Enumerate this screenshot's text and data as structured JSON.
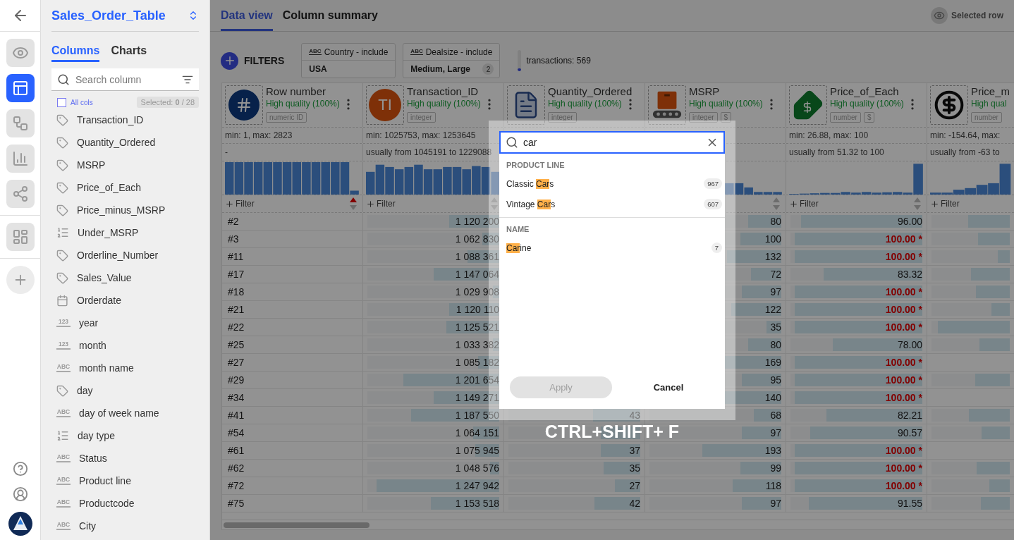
{
  "rail": {
    "items": [
      {
        "kind": "preview",
        "selected": false
      },
      {
        "kind": "table",
        "selected": true
      },
      {
        "kind": "flow",
        "selected": false
      },
      {
        "kind": "chart",
        "selected": false
      },
      {
        "kind": "network",
        "selected": false
      },
      {
        "kind": "dashboard",
        "selected": false
      }
    ]
  },
  "sidebar": {
    "title": "Sales_Order_Table",
    "tabs": [
      {
        "label": "Columns",
        "selected": true
      },
      {
        "label": "Charts",
        "selected": false
      }
    ],
    "search": {
      "placeholder": "Search column"
    },
    "all_cols": {
      "label": "All cols",
      "checked": false
    },
    "selected_count": "Selected: **0** / 28",
    "columns": [
      {
        "name": "Transaction_ID",
        "kind": "measure"
      },
      {
        "name": "Quantity_Ordered",
        "kind": "measure"
      },
      {
        "name": "MSRP",
        "kind": "measure"
      },
      {
        "name": "Price_of_Each",
        "kind": "measure"
      },
      {
        "name": "Price_minus_MSRP",
        "kind": "measure"
      },
      {
        "name": "Under_MSRP",
        "kind": "binary"
      },
      {
        "name": "Orderline_Number",
        "kind": "measure"
      },
      {
        "name": "Sales_Value",
        "kind": "measure"
      },
      {
        "name": "Orderdate",
        "kind": "date"
      },
      {
        "name": "year",
        "kind": "label",
        "type_label": "123"
      },
      {
        "name": "month",
        "kind": "label",
        "type_label": "123"
      },
      {
        "name": "month name",
        "kind": "label",
        "type_label": "ABC"
      },
      {
        "name": "day",
        "kind": "measure"
      },
      {
        "name": "day of week name",
        "kind": "label",
        "type_label": "ABC"
      },
      {
        "name": "day type",
        "kind": "binary"
      },
      {
        "name": "Status",
        "kind": "label",
        "type_label": "ABC"
      },
      {
        "name": "Product line",
        "kind": "label",
        "type_label": "ABC"
      },
      {
        "name": "Productcode",
        "kind": "label",
        "type_label": "ABC"
      },
      {
        "name": "City",
        "kind": "label",
        "type_label": "ABC"
      }
    ]
  },
  "tabs": [
    {
      "label": "Data view",
      "selected": true
    },
    {
      "label": "Column summary",
      "selected": false
    }
  ],
  "selected_row": {
    "label": "Selected row"
  },
  "filters": {
    "label": "FILTERS",
    "chips": [
      {
        "type_label": "ABC",
        "title": "Country - include",
        "value": "USA"
      },
      {
        "type_label": "ABC",
        "title": "Dealsize - include",
        "value": "Medium, Large",
        "count": "2"
      }
    ],
    "transactions": {
      "label": "transactions: 569",
      "level": 0.15
    }
  },
  "table": {
    "columns": [
      {
        "title": "Row number",
        "kind": "hash",
        "quality": "High quality (100%)",
        "tags": [
          "numeric ID"
        ],
        "min_max": "min: 1, max: 2823",
        "usually": "-",
        "filter": "Filter",
        "sort_asc": true,
        "cut": false
      },
      {
        "title": "Transaction_ID",
        "kind": "avatar",
        "avatar_text": "TI",
        "quality": "High quality (100%)",
        "tags": [
          "integer"
        ],
        "min_max": "min: 1025753, max: 1253645",
        "usually": "usually from 1045191 to 1229088",
        "filter": "Filter",
        "sort_asc": false,
        "cut": false
      },
      {
        "title": "Quantity_Ordered",
        "kind": "document",
        "quality": "High quality (100%)",
        "tags": [
          "integer"
        ],
        "cut": false
      },
      {
        "title": "MSRP",
        "kind": "conveyor",
        "quality": "High quality (100%)",
        "tags": [
          "integer",
          "$"
        ],
        "sort_asc": false,
        "cut": false
      },
      {
        "title": "Price_of_Each",
        "kind": "price-tag",
        "quality": "High quality (100%)",
        "tags": [
          "number",
          "$"
        ],
        "min_max": "min: 26.88, max: 100",
        "usually": "usually from 51.32 to 100",
        "filter": "Filter",
        "sort_asc": false,
        "cut": false
      },
      {
        "title": "Price_m",
        "kind": "dollar-cycle",
        "quality": "High qual",
        "tags": [
          "number"
        ],
        "min_max": "min: -154.64, max:",
        "usually": "usually from -63 to",
        "filter": "Filter",
        "cut": true
      }
    ],
    "rows": [
      {
        "cells": [
          {
            "value": "#2"
          },
          {
            "value": "1 120 200",
            "level": 0.38
          },
          null,
          {
            "value": "80",
            "level": 0.25
          },
          {
            "value": "96.00",
            "level": 0.92,
            "flagged": false
          },
          {
            "level": 0.53
          }
        ]
      },
      {
        "cells": [
          {
            "value": "#3"
          },
          {
            "value": "1 062 830",
            "level": 0.13
          },
          null,
          {
            "value": "100",
            "level": 0.31
          },
          {
            "value": "100.00 *",
            "level": 0.97,
            "flagged": true
          },
          {
            "level": 0.41
          }
        ]
      },
      {
        "cells": [
          {
            "value": "#11"
          },
          {
            "value": "1 088 361",
            "level": 0.24
          },
          null,
          {
            "value": "132",
            "level": 0.41
          },
          {
            "value": "100.00 *",
            "level": 0.97,
            "flagged": true
          },
          {
            "level": 0.15
          }
        ]
      },
      {
        "cells": [
          {
            "value": "#17"
          },
          {
            "value": "1 147 064",
            "level": 0.5
          },
          null,
          {
            "value": "72",
            "level": 0.23
          },
          {
            "value": "83.32",
            "level": 0.75,
            "flagged": false
          },
          {
            "level": 0.5
          }
        ]
      },
      {
        "cells": [
          {
            "value": "#18"
          },
          {
            "value": "1 029 908",
            "level": 0.05
          },
          null,
          {
            "value": "97",
            "level": 0.3
          },
          {
            "value": "100.00 *",
            "level": 0.97,
            "flagged": true
          },
          {
            "level": 0.43
          }
        ]
      },
      {
        "cells": [
          {
            "value": "#21"
          },
          {
            "value": "1 120 110",
            "level": 0.38
          },
          null,
          {
            "value": "122",
            "level": 0.38
          },
          {
            "value": "100.00 *",
            "level": 0.97,
            "flagged": true
          },
          {
            "level": 0.23
          }
        ]
      },
      {
        "cells": [
          {
            "value": "#22"
          },
          {
            "value": "1 125 521",
            "level": 0.4
          },
          null,
          {
            "value": "35",
            "level": 0.11
          },
          {
            "value": "100.00 *",
            "level": 0.97,
            "flagged": true
          },
          {
            "level": 0.92
          }
        ]
      },
      {
        "cells": [
          {
            "value": "#25"
          },
          {
            "value": "1 033 382",
            "level": 0.05
          },
          null,
          {
            "value": "80",
            "level": 0.25
          },
          {
            "value": "78.00",
            "level": 0.68,
            "flagged": false
          },
          {
            "level": 0.39
          }
        ]
      },
      {
        "cells": [
          {
            "value": "#27"
          },
          {
            "value": "1 085 182",
            "level": 0.16
          },
          null,
          {
            "value": "169",
            "level": 0.53
          },
          {
            "value": "100.00 *",
            "level": 0.97,
            "flagged": true
          },
          null
        ]
      },
      {
        "cells": [
          {
            "value": "#29"
          },
          {
            "value": "1 201 654",
            "level": 0.73
          },
          null,
          {
            "value": "95",
            "level": 0.3
          },
          {
            "value": "100.00 *",
            "level": 0.97,
            "flagged": true
          },
          {
            "level": 0.44
          }
        ]
      },
      {
        "cells": [
          {
            "value": "#34"
          },
          {
            "value": "1 149 271",
            "level": 0.5
          },
          null,
          {
            "value": "140",
            "level": 0.44
          },
          {
            "value": "100.00 *",
            "level": 0.97,
            "flagged": true
          },
          null
        ]
      },
      {
        "cells": [
          {
            "value": "#41"
          },
          {
            "value": "1 187 550",
            "level": 0.67
          },
          {
            "value": "43",
            "level": 0.36
          },
          {
            "value": "68",
            "level": 0.21
          },
          {
            "value": "82.21",
            "level": 0.73,
            "flagged": false
          },
          {
            "level": 0.52
          }
        ]
      },
      {
        "cells": [
          {
            "value": "#54"
          },
          {
            "value": "1 064 151",
            "level": 0.2
          },
          {
            "level": 0.3
          },
          {
            "value": "97",
            "level": 0.3
          },
          {
            "value": "90.57",
            "level": 0.85,
            "flagged": false
          },
          {
            "level": 0.36
          }
        ]
      },
      {
        "cells": [
          {
            "value": "#61"
          },
          {
            "value": "1 075 945",
            "level": 0.18
          },
          {
            "value": "37",
            "level": 0.3
          },
          {
            "value": "193",
            "level": 0.6
          },
          {
            "value": "100.00 *",
            "level": 0.97,
            "flagged": true
          },
          null
        ]
      },
      {
        "cells": [
          {
            "value": "#62"
          },
          {
            "value": "1 048 576",
            "level": 0.07
          },
          {
            "value": "35",
            "level": 0.28
          },
          {
            "value": "99",
            "level": 0.31
          },
          {
            "value": "100.00 *",
            "level": 0.97,
            "flagged": true
          },
          {
            "level": 0.42
          }
        ]
      },
      {
        "cells": [
          {
            "value": "#72"
          },
          {
            "value": "1 247 942",
            "level": 0.93
          },
          {
            "value": "27",
            "level": 0.19
          },
          {
            "value": "118",
            "level": 0.37
          },
          {
            "value": "100.00 *",
            "level": 0.97,
            "flagged": true
          },
          {
            "level": 0.26
          }
        ]
      },
      {
        "cells": [
          {
            "value": "#75"
          },
          {
            "value": "1 153 518",
            "level": 0.52
          },
          {
            "value": "42",
            "level": 0.35
          },
          {
            "value": "97",
            "level": 0.3
          },
          {
            "value": "91.55",
            "level": 0.86,
            "flagged": false
          },
          {
            "level": 0.37
          }
        ]
      }
    ]
  },
  "search_dialog": {
    "query": "car",
    "groups": [
      {
        "title": "PRODUCT LINE",
        "items": [
          {
            "prefix": "Classic ",
            "match": "Car",
            "suffix": "s",
            "count": "967"
          },
          {
            "prefix": "Vintage ",
            "match": "Car",
            "suffix": "s",
            "count": "607"
          }
        ]
      },
      {
        "title": "NAME",
        "items": [
          {
            "match": "Car",
            "suffix": "ine",
            "count": "7"
          }
        ]
      }
    ],
    "apply": {
      "label": "Apply",
      "disabled": true
    },
    "cancel": {
      "label": "Cancel"
    },
    "shortcut": "CTRL+SHIFT+ F"
  }
}
